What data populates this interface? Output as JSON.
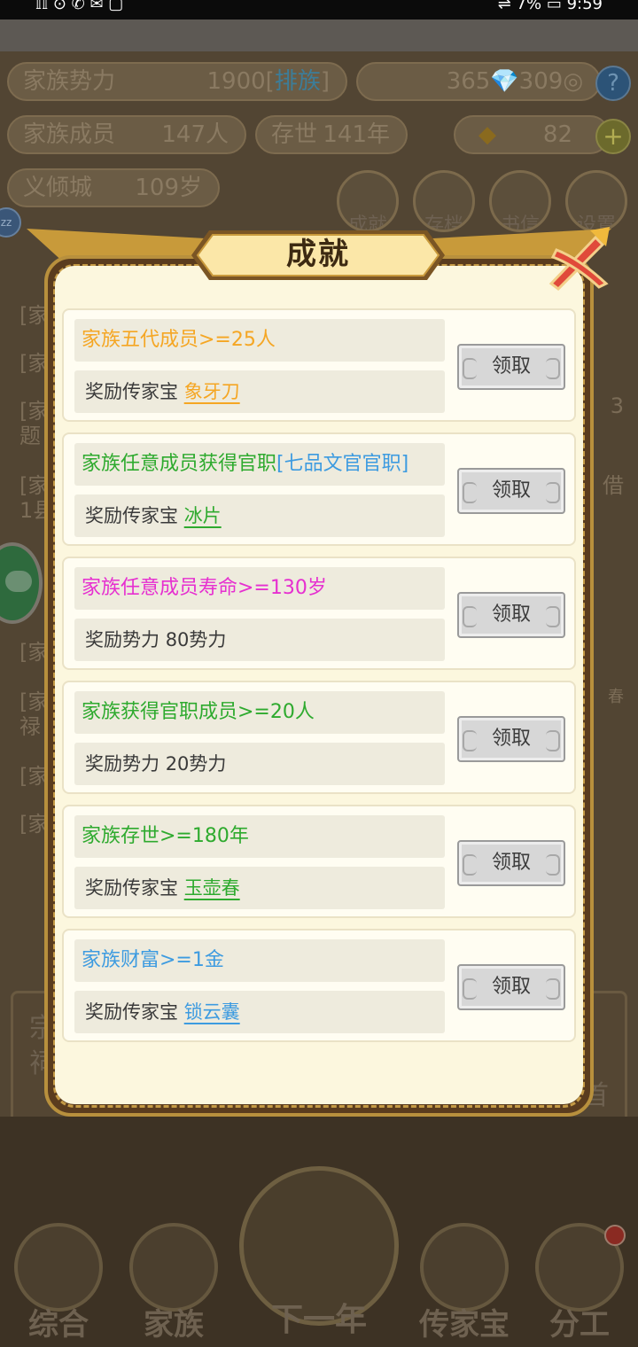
{
  "statusbar": {
    "left": "𝕀𝕀 ⊙ ✆ ✉ ▢",
    "right": "⇌ 7% ▭ 9:59"
  },
  "background": {
    "family_power_label": "家族势力",
    "family_power_value": "1900",
    "ranking_label": "排族",
    "currency": "365💎309◎",
    "family_members_label": "家族成员",
    "family_members_value": "147人",
    "survived_label": "存世",
    "survived_value": "141年",
    "gold_value": "82",
    "city_label": "义倾城",
    "city_value": "109岁",
    "top_buttons": [
      "成就",
      "存档",
      "书信",
      "设置"
    ],
    "side_items": [
      "[家",
      "[家",
      "[家",
      "题",
      "[家",
      "1县",
      "[家",
      "[家",
      "[家",
      "禄",
      "[家",
      "[家"
    ],
    "side_right": [
      "3",
      "借",
      "春"
    ],
    "nav": [
      "综合",
      "家族",
      "下一年",
      "传家宝",
      "分工"
    ],
    "panel_left": [
      "宗",
      "祠"
    ],
    "panel_right": "首"
  },
  "modal": {
    "title": "成就",
    "achievements": [
      {
        "goal": "家族五代成员>=25人",
        "goal_extra": "",
        "goal_color": "#f5a623",
        "extra_color": "",
        "reward_prefix": "奖励传家宝",
        "reward_item": "象牙刀",
        "reward_item_color": "#f5a623",
        "button": "领取"
      },
      {
        "goal": "家族任意成员获得官职",
        "goal_extra": "[七品文官官职]",
        "goal_color": "#2eaa2e",
        "extra_color": "#3d9be0",
        "reward_prefix": "奖励传家宝",
        "reward_item": "冰片",
        "reward_item_color": "#2eaa2e",
        "button": "领取"
      },
      {
        "goal": "家族任意成员寿命>=130岁",
        "goal_extra": "",
        "goal_color": "#e62fd0",
        "extra_color": "",
        "reward_prefix": "奖励势力",
        "reward_item": "80势力",
        "reward_item_color": "#3a3a3a",
        "button": "领取"
      },
      {
        "goal": "家族获得官职成员>=20人",
        "goal_extra": "",
        "goal_color": "#2eaa2e",
        "extra_color": "",
        "reward_prefix": "奖励势力",
        "reward_item": "20势力",
        "reward_item_color": "#3a3a3a",
        "button": "领取"
      },
      {
        "goal": "家族存世>=180年",
        "goal_extra": "",
        "goal_color": "#2eaa2e",
        "extra_color": "",
        "reward_prefix": "奖励传家宝",
        "reward_item": "玉壶春",
        "reward_item_color": "#2eaa2e",
        "button": "领取"
      },
      {
        "goal": "家族财富>=1金",
        "goal_extra": "",
        "goal_color": "#3d9be0",
        "extra_color": "",
        "reward_prefix": "奖励传家宝",
        "reward_item": "锁云囊",
        "reward_item_color": "#3d9be0",
        "button": "领取"
      }
    ]
  }
}
